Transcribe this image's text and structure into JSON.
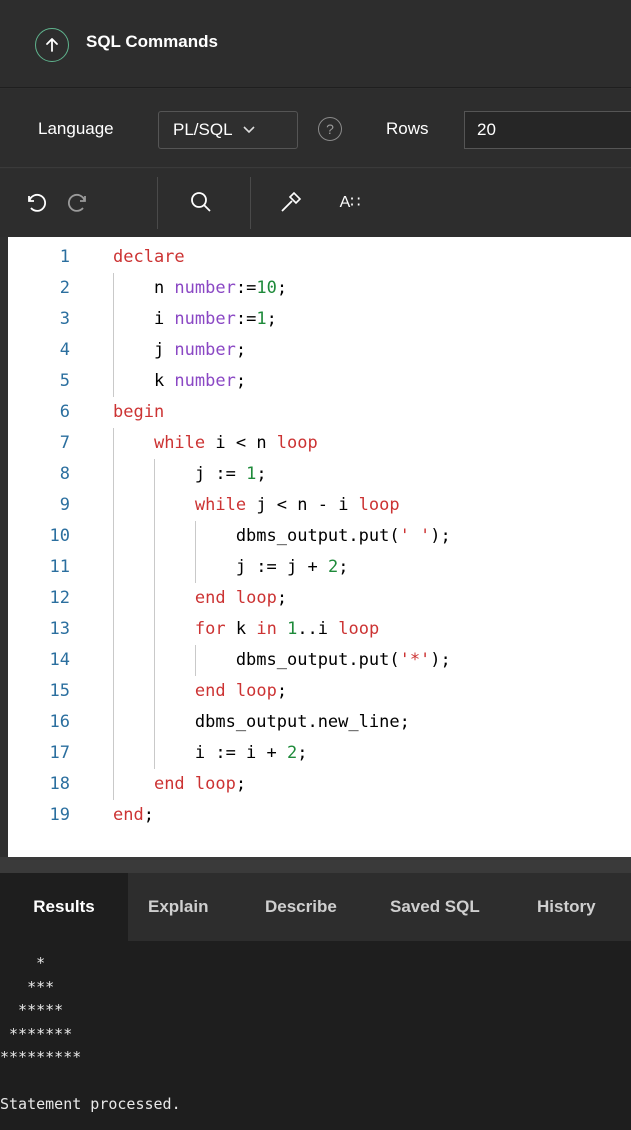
{
  "header": {
    "title": "SQL Commands",
    "collapse_icon": "arrow-up-circle-icon"
  },
  "settings": {
    "language_label": "Language",
    "language_value": "PL/SQL",
    "help_glyph": "?",
    "rows_label": "Rows",
    "rows_value": "20"
  },
  "toolbar": {
    "undo_icon": "undo-icon",
    "redo_icon": "redo-icon",
    "find_icon": "search-icon",
    "builder_icon": "hammer-icon",
    "format_label": "A∷"
  },
  "editor": {
    "lines": [
      {
        "n": "1",
        "tokens": [
          [
            "kw",
            "declare"
          ]
        ]
      },
      {
        "n": "2",
        "tokens": [
          [
            "",
            "    n "
          ],
          [
            "ty",
            "number"
          ],
          [
            "",
            ":="
          ],
          [
            "nm",
            "10"
          ],
          [
            "",
            ";"
          ]
        ]
      },
      {
        "n": "3",
        "tokens": [
          [
            "",
            "    i "
          ],
          [
            "ty",
            "number"
          ],
          [
            "",
            ":="
          ],
          [
            "nm",
            "1"
          ],
          [
            "",
            ";"
          ]
        ]
      },
      {
        "n": "4",
        "tokens": [
          [
            "",
            "    j "
          ],
          [
            "ty",
            "number"
          ],
          [
            "",
            ";"
          ]
        ]
      },
      {
        "n": "5",
        "tokens": [
          [
            "",
            "    k "
          ],
          [
            "ty",
            "number"
          ],
          [
            "",
            ";"
          ]
        ]
      },
      {
        "n": "6",
        "tokens": [
          [
            "kw",
            "begin"
          ]
        ]
      },
      {
        "n": "7",
        "tokens": [
          [
            "",
            "    "
          ],
          [
            "kw",
            "while"
          ],
          [
            "",
            " i < n "
          ],
          [
            "kw",
            "loop"
          ]
        ]
      },
      {
        "n": "8",
        "tokens": [
          [
            "",
            "        j := "
          ],
          [
            "nm",
            "1"
          ],
          [
            "",
            ";"
          ]
        ]
      },
      {
        "n": "9",
        "tokens": [
          [
            "",
            "        "
          ],
          [
            "kw",
            "while"
          ],
          [
            "",
            " j < n - i "
          ],
          [
            "kw",
            "loop"
          ]
        ]
      },
      {
        "n": "10",
        "tokens": [
          [
            "",
            "            dbms_output.put("
          ],
          [
            "st",
            "' '"
          ],
          [
            "",
            ");"
          ]
        ]
      },
      {
        "n": "11",
        "tokens": [
          [
            "",
            "            j := j + "
          ],
          [
            "nm",
            "2"
          ],
          [
            "",
            ";"
          ]
        ]
      },
      {
        "n": "12",
        "tokens": [
          [
            "",
            "        "
          ],
          [
            "kw",
            "end"
          ],
          [
            "",
            " "
          ],
          [
            "kw",
            "loop"
          ],
          [
            "",
            ";"
          ]
        ]
      },
      {
        "n": "13",
        "tokens": [
          [
            "",
            "        "
          ],
          [
            "kw",
            "for"
          ],
          [
            "",
            " k "
          ],
          [
            "kw",
            "in"
          ],
          [
            "",
            " "
          ],
          [
            "nm",
            "1"
          ],
          [
            "",
            "..i "
          ],
          [
            "kw",
            "loop"
          ]
        ]
      },
      {
        "n": "14",
        "tokens": [
          [
            "",
            "            dbms_output.put("
          ],
          [
            "st",
            "'*'"
          ],
          [
            "",
            ");"
          ]
        ]
      },
      {
        "n": "15",
        "tokens": [
          [
            "",
            "        "
          ],
          [
            "kw",
            "end"
          ],
          [
            "",
            " "
          ],
          [
            "kw",
            "loop"
          ],
          [
            "",
            ";"
          ]
        ]
      },
      {
        "n": "16",
        "tokens": [
          [
            "",
            "        dbms_output.new_line;"
          ]
        ]
      },
      {
        "n": "17",
        "tokens": [
          [
            "",
            "        i := i + "
          ],
          [
            "nm",
            "2"
          ],
          [
            "",
            ";"
          ]
        ]
      },
      {
        "n": "18",
        "tokens": [
          [
            "",
            "    "
          ],
          [
            "kw",
            "end"
          ],
          [
            "",
            " "
          ],
          [
            "kw",
            "loop"
          ],
          [
            "",
            ";"
          ]
        ]
      },
      {
        "n": "19",
        "tokens": [
          [
            "kw",
            "end"
          ],
          [
            "",
            ";"
          ]
        ]
      }
    ]
  },
  "results": {
    "tabs": [
      "Results",
      "Explain",
      "Describe",
      "Saved SQL",
      "History"
    ],
    "active_tab": "Results",
    "output_lines": [
      "    *",
      "   ***",
      "  *****",
      " *******",
      "*********",
      "",
      "Statement processed."
    ]
  }
}
